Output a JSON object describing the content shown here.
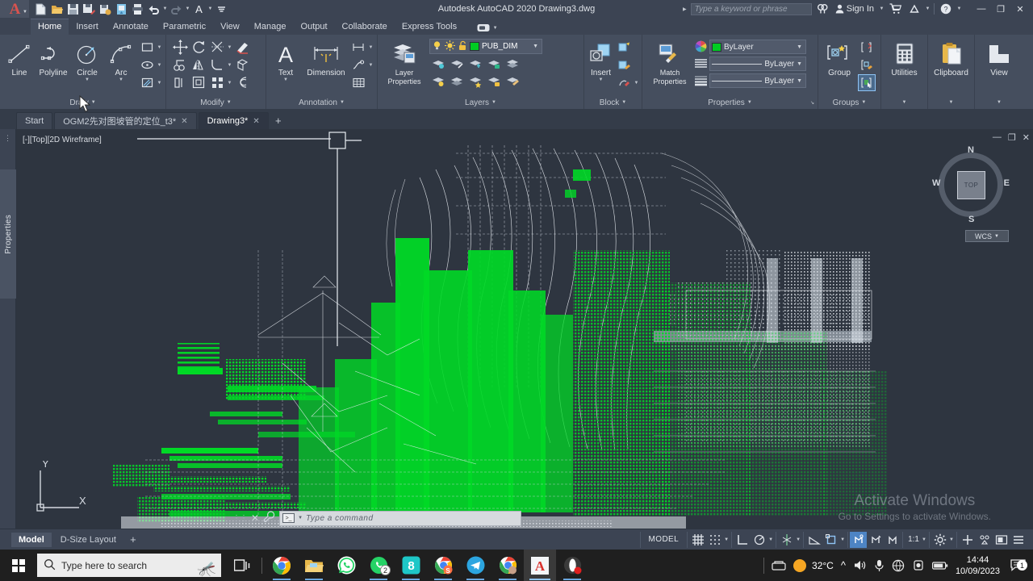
{
  "app": {
    "title": "Autodesk AutoCAD 2020   Drawing3.dwg",
    "product": "Autodesk AutoCAD 2020",
    "document": "Drawing3.dwg",
    "logo_letter": "A"
  },
  "titlebar": {
    "search_placeholder": "Type a keyword or phrase",
    "sign_in": "Sign In",
    "quick_access": [
      {
        "name": "new-icon",
        "label": "New"
      },
      {
        "name": "open-icon",
        "label": "Open"
      },
      {
        "name": "save-icon",
        "label": "Save"
      },
      {
        "name": "save-as-icon",
        "label": "Save As"
      },
      {
        "name": "export-icon",
        "label": "Export"
      },
      {
        "name": "cloud-icon",
        "label": "Save to Web & Mobile"
      },
      {
        "name": "plot-icon",
        "label": "Plot"
      },
      {
        "name": "undo-icon",
        "label": "Undo"
      },
      {
        "name": "redo-icon",
        "label": "Redo"
      },
      {
        "name": "text-style-icon",
        "label": "A"
      },
      {
        "name": "customize-icon",
        "label": "Customize"
      }
    ],
    "window_buttons": {
      "minimize": "—",
      "maximize": "❐",
      "close": "✕"
    }
  },
  "ribbon": {
    "tabs": [
      {
        "label": "Home",
        "active": true
      },
      {
        "label": "Insert",
        "active": false
      },
      {
        "label": "Annotate",
        "active": false
      },
      {
        "label": "Parametric",
        "active": false
      },
      {
        "label": "View",
        "active": false
      },
      {
        "label": "Manage",
        "active": false
      },
      {
        "label": "Output",
        "active": false
      },
      {
        "label": "Collaborate",
        "active": false
      },
      {
        "label": "Express Tools",
        "active": false
      }
    ],
    "panels": {
      "draw": {
        "title": "Draw",
        "buttons": [
          {
            "label": "Line",
            "icon": "line-icon"
          },
          {
            "label": "Polyline",
            "icon": "polyline-icon"
          },
          {
            "label": "Circle",
            "icon": "circle-icon"
          },
          {
            "label": "Arc",
            "icon": "arc-icon"
          }
        ],
        "small": [
          "rectangle-icon",
          "ellipse-icon",
          "hatch-icon"
        ]
      },
      "modify": {
        "title": "Modify",
        "small": [
          "move-icon",
          "rotate-icon",
          "trim-icon",
          "erase-icon",
          "copy-icon",
          "mirror-icon",
          "fillet-icon",
          "array-icon",
          "stretch-icon",
          "scale-icon",
          "explode-icon",
          "offset-icon"
        ]
      },
      "annotation": {
        "title": "Annotation",
        "buttons": [
          {
            "label": "Text",
            "icon": "text-icon"
          },
          {
            "label": "Dimension",
            "icon": "dimension-icon"
          }
        ],
        "small": [
          "leader-icon",
          "multileader-icon",
          "table-icon"
        ]
      },
      "layers": {
        "title": "Layers",
        "layer_properties_label": "Layer\nProperties",
        "current_layer": "PUB_DIM",
        "layer_color": "#00cc22",
        "state_icons": [
          "bulb-icon",
          "sun-icon",
          "unlock-icon"
        ],
        "small": [
          "layer-isolate-icon",
          "layer-freeze-icon",
          "layer-off-icon",
          "layer-lock-icon",
          "layer-merge-icon",
          "layer-unisolate-icon",
          "layer-thaw-icon",
          "layer-on-icon",
          "layer-unlock-icon",
          "layer-match-icon"
        ]
      },
      "block": {
        "title": "Block",
        "buttons": [
          {
            "label": "Insert",
            "icon": "insert-block-icon"
          }
        ],
        "small": [
          "create-block-icon",
          "edit-block-icon",
          "attribute-icon"
        ]
      },
      "properties": {
        "title": "Properties",
        "match_label": "Match\nProperties",
        "color": "ByLayer",
        "linetype": "ByLayer",
        "lineweight": "ByLayer",
        "color_swatch": "#00cc22"
      },
      "groups": {
        "title": "Groups",
        "buttons": [
          {
            "label": "Group",
            "icon": "group-icon"
          }
        ],
        "small": [
          "ungroup-icon",
          "group-edit-icon",
          "group-select-icon"
        ]
      },
      "utilities": {
        "title": "Utilities",
        "label": "Utilities",
        "icon": "calculator-icon"
      },
      "clipboard": {
        "title": "Clipboard",
        "label": "Clipboard",
        "icon": "clipboard-icon"
      },
      "view": {
        "title": "View",
        "label": "View",
        "icon": "view-icon"
      }
    }
  },
  "file_tabs": [
    {
      "label": "Start",
      "closable": false,
      "active": false
    },
    {
      "label": "OGM2先对图坡管的定位_t3*",
      "closable": true,
      "active": false
    },
    {
      "label": "Drawing3*",
      "closable": true,
      "active": true
    }
  ],
  "file_tabs_add": "+",
  "viewport": {
    "label": "[-][Top][2D Wireframe]",
    "background": "#2e3540",
    "entity_colors": {
      "primary": "#00d926",
      "secondary": "#e9edf2"
    },
    "viewcube": {
      "top": "TOP",
      "north": "N",
      "south": "S",
      "west": "W",
      "east": "E"
    },
    "wcs_label": "WCS",
    "ucs": {
      "x": "X",
      "y": "Y"
    },
    "window_controls": {
      "minimize": "—",
      "restore": "❐",
      "close": "✕"
    }
  },
  "left_rail": {
    "label": "Properties"
  },
  "watermark": {
    "line1": "Activate Windows",
    "line2": "Go to Settings to activate Windows."
  },
  "command_line": {
    "placeholder": "Type a command",
    "close": "✕",
    "customize": "wrench-icon"
  },
  "status_bar": {
    "layout_tabs": [
      {
        "label": "Model",
        "active": true
      },
      {
        "label": "D-Size Layout",
        "active": false
      }
    ],
    "layout_add": "+",
    "model_button": "MODEL",
    "scale": "1:1",
    "toggles": [
      {
        "name": "grid-display-icon",
        "on": false
      },
      {
        "name": "snap-mode-icon",
        "on": false
      },
      {
        "name": "ortho-mode-icon",
        "on": false
      },
      {
        "name": "polar-tracking-icon",
        "on": false
      },
      {
        "name": "object-snap-tracking-icon",
        "on": false
      },
      {
        "name": "dynamic-ucs-icon",
        "on": false
      },
      {
        "name": "object-snap-icon",
        "on": false
      },
      {
        "name": "lineweight-icon",
        "on": true
      },
      {
        "name": "transparency-icon",
        "on": false
      },
      {
        "name": "selection-cycling-icon",
        "on": false
      },
      {
        "name": "annotation-settings-icon",
        "on": false
      },
      {
        "name": "isolate-objects-icon",
        "on": false
      },
      {
        "name": "hardware-accel-icon",
        "on": false
      },
      {
        "name": "customization-icon",
        "on": false
      }
    ]
  },
  "taskbar": {
    "search_placeholder": "Type here to search",
    "start_icon": "windows-start-icon",
    "apps": [
      {
        "name": "chrome-icon",
        "running": true,
        "active": false
      },
      {
        "name": "file-explorer-icon",
        "running": true,
        "active": false
      },
      {
        "name": "whatsapp-icon",
        "running": false,
        "active": false
      },
      {
        "name": "whatsapp-icon-2",
        "running": true,
        "active": false,
        "badge": "2"
      },
      {
        "name": "eight-app-icon",
        "running": true,
        "active": false
      },
      {
        "name": "chrome-icon-2",
        "running": true,
        "active": false
      },
      {
        "name": "telegram-icon",
        "running": true,
        "active": false
      },
      {
        "name": "chrome-icon-3",
        "running": true,
        "active": false
      },
      {
        "name": "autocad-icon",
        "running": true,
        "active": true
      },
      {
        "name": "opera-icon",
        "running": true,
        "active": false
      }
    ],
    "tray": {
      "temperature": "32°C",
      "weather_icon": "sun-icon",
      "time": "14:44",
      "date": "10/09/2023",
      "notification_count": "1",
      "icons": [
        "chevron-up-icon",
        "volume-icon",
        "microphone-icon",
        "network-icon",
        "camera-icon",
        "battery-icon"
      ]
    }
  },
  "chart_data": null
}
